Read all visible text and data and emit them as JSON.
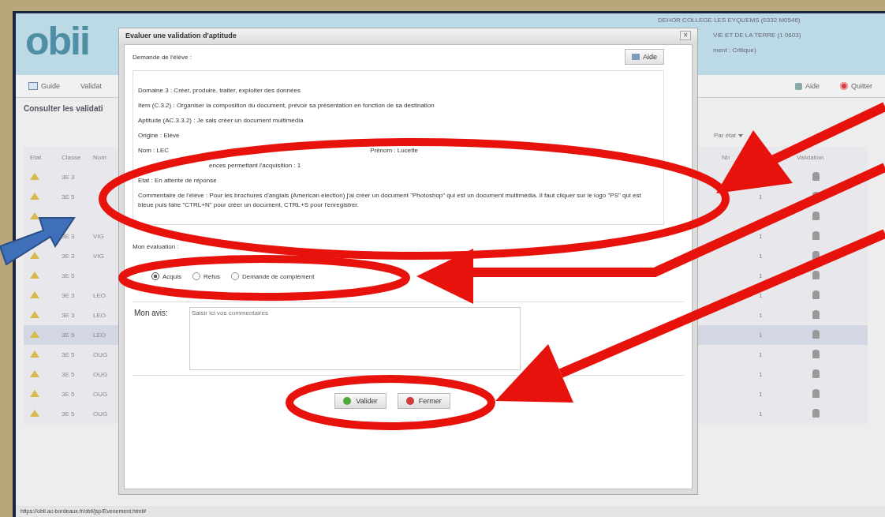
{
  "app_header": {
    "logo": "obii",
    "info_lines": [
      "DEHOR COLLEGE LES EYQUEMS (0332 M0546)",
      "VIE ET DE LA TERRE (1 0603)",
      "ment : Critique)"
    ]
  },
  "toolbar": {
    "left": [
      {
        "label": "Guide"
      },
      {
        "label": "Validat"
      }
    ],
    "right": [
      {
        "label": "Aide"
      },
      {
        "label": "Quitter"
      }
    ]
  },
  "page_title": "Consulter les validati",
  "filter": {
    "label": "Par état"
  },
  "table": {
    "columns": [
      "Etat",
      "Classe",
      "Nom",
      "Nb",
      "Validation"
    ],
    "rows": [
      {
        "classe": "3E 3",
        "selected": false
      },
      {
        "classe": "3E 5",
        "nb": "1",
        "selected": false
      },
      {
        "selected": false
      },
      {
        "classe": "3E 3",
        "nom": "VIG",
        "nb": "1",
        "selected": false
      },
      {
        "classe": "3E 3",
        "nom": "VIG",
        "nb": "1",
        "selected": false
      },
      {
        "classe": "3E 5",
        "nb": "1",
        "selected": false
      },
      {
        "classe": "3E 3",
        "nom": "LEO",
        "nb": "1",
        "selected": false
      },
      {
        "classe": "3E 3",
        "nom": "LEO",
        "nb": "1",
        "selected": false
      },
      {
        "classe": "3E 5",
        "nom": "LEO",
        "nb": "1",
        "selected": true
      },
      {
        "classe": "3E 5",
        "nom": "OUG",
        "nb": "1",
        "selected": false
      },
      {
        "classe": "3E 5",
        "nom": "OUG",
        "nb": "1",
        "selected": false
      },
      {
        "classe": "3E 5",
        "nom": "OUG",
        "nb": "1",
        "selected": false
      },
      {
        "classe": "3E 5",
        "nom": "OUG",
        "nb": "1",
        "selected": false
      }
    ]
  },
  "dialog": {
    "title": "Evaluer une validation d'aptitude",
    "close": "×",
    "section_label": "Demande de l'élève :",
    "help_button": "Aide",
    "details": [
      {
        "text": "Domaine 3 : Créer, produire, traiter, exploiter des données"
      },
      {
        "text": "Item (C.3.2) : Organiser la composition du document, prévoir sa présentation en fonction de sa destination"
      },
      {
        "text": "Aptitude (AC.3.3.2) : Je sais créer un document multimédia"
      },
      {
        "text": "Origine : Elève"
      },
      {
        "text": "Nom : LEC",
        "text_2": "Prénom : Lucette"
      },
      {
        "text": "ences permettant l'acquisition : 1",
        "kind": "partial"
      },
      {
        "text": "Etat : En attente de réponse"
      },
      {
        "text": "Commentaire de l'élève : Pour les brochures d'anglais (American election) j'ai créer un document \"Photoshop\" qui est un document multimédia. Il faut cliquer sur le logo \"PS\" qui est bleue puis faire \"CTRL+N\" pour créer un document, CTRL+S pour l'enregistrer."
      }
    ],
    "evaluation_label": "Mon évaluation :",
    "options": [
      {
        "label": "Acquis",
        "selected": true
      },
      {
        "label": "Refus",
        "selected": false
      },
      {
        "label": "Demande de complément",
        "selected": false
      }
    ],
    "opinion_label": "Mon avis:",
    "opinion": {
      "placeholder": "Saisir ici vos commentaires"
    },
    "buttons": [
      {
        "label": "Valider",
        "kind": "ok"
      },
      {
        "label": "Fermer",
        "kind": "close"
      }
    ]
  },
  "status_bar": "https://obii.ac-bordeaux.fr/obii/jsp/Evenement.html#",
  "annotations": [
    {
      "kind": "ellipse",
      "color": "#e8120c"
    },
    {
      "kind": "ellipse",
      "color": "#e8120c"
    },
    {
      "kind": "ellipse",
      "color": "#e8120c"
    },
    {
      "kind": "arrow",
      "color": "#e8120c"
    },
    {
      "kind": "arrow",
      "color": "#e8120c"
    },
    {
      "kind": "arrow",
      "color": "#e8120c"
    },
    {
      "kind": "arrow",
      "color": "#3f6fb8"
    }
  ]
}
